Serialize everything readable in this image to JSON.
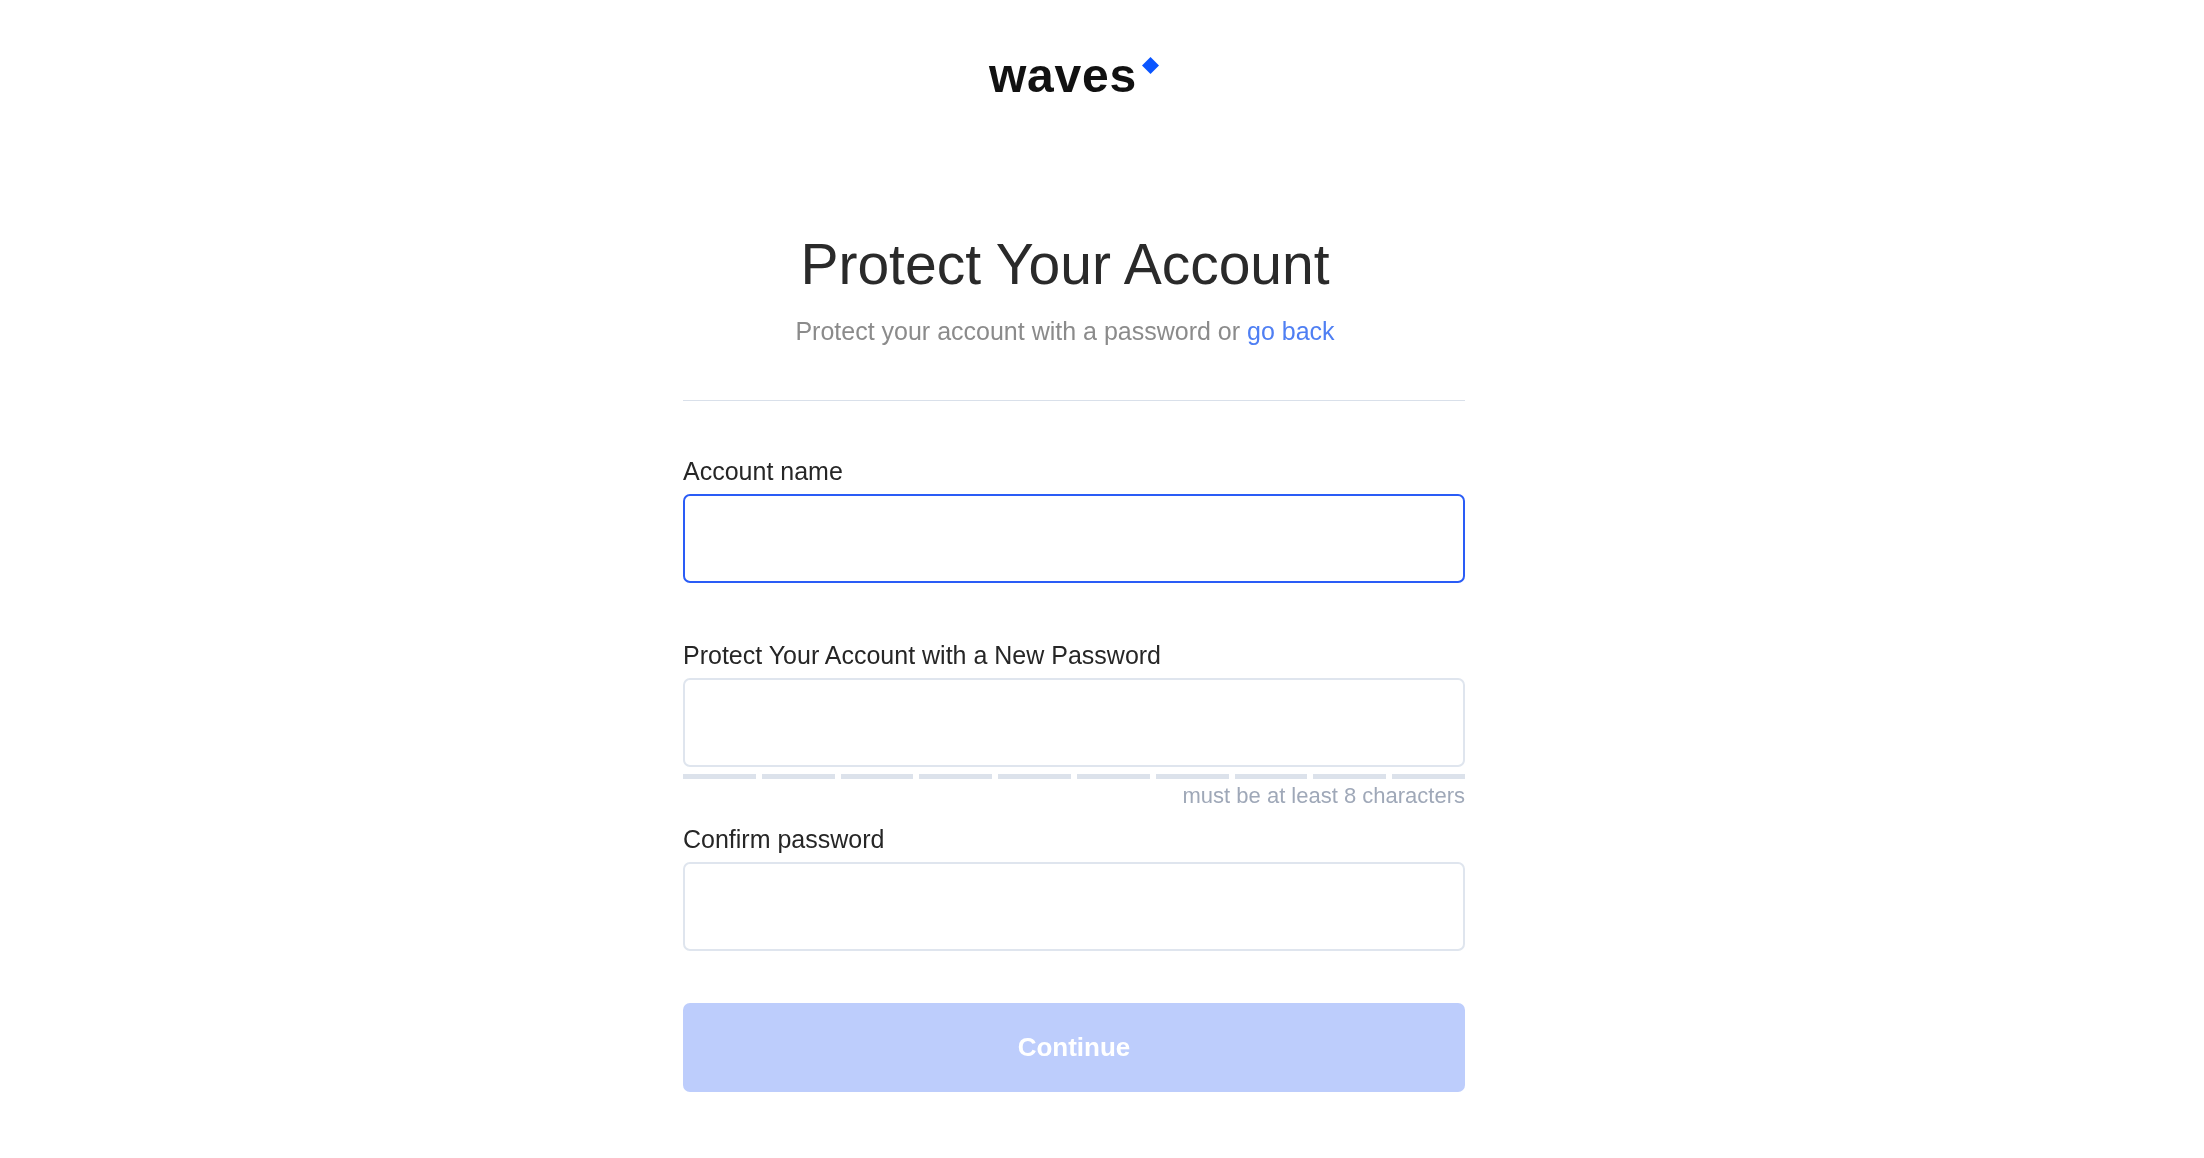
{
  "logo": {
    "text": "waves"
  },
  "title": "Protect Your Account",
  "subtitle": {
    "text": "Protect your account with a password or",
    "link": "go back"
  },
  "fields": [
    {
      "label": "Account name",
      "focused": true
    },
    {
      "label": "Protect Your Account with a New Password",
      "focused": false,
      "strength": {
        "level": 0
      },
      "hint": "must be at least 8 characters"
    },
    {
      "label": "Confirm password",
      "focused": false
    }
  ],
  "button": {
    "label": "Continue",
    "disabled": true
  }
}
